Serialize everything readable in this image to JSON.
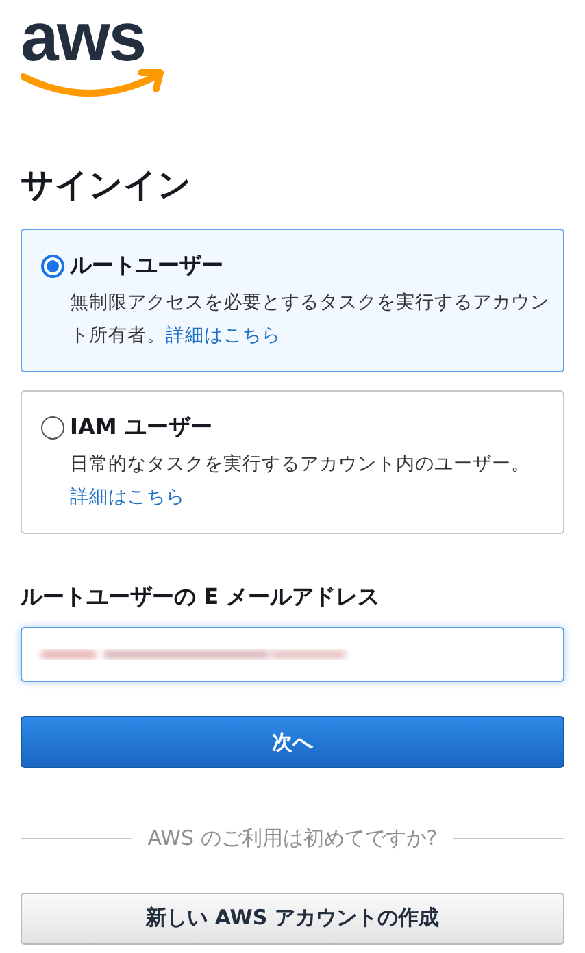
{
  "logo": {
    "text": "aws"
  },
  "heading": "サインイン",
  "user_types": [
    {
      "label": "ルートユーザー",
      "description": "無制限アクセスを必要とするタスクを実行するアカウント所有者。",
      "link": "詳細はこちら",
      "selected": true
    },
    {
      "label": "IAM ユーザー",
      "description": "日常的なタスクを実行するアカウント内のユーザー。",
      "link": "詳細はこちら",
      "selected": false
    }
  ],
  "email": {
    "label": "ルートユーザーの E メールアドレス"
  },
  "next_button": "次へ",
  "divider_text": "AWS のご利用は初めてですか?",
  "create_account_button": "新しい AWS アカウントの作成"
}
